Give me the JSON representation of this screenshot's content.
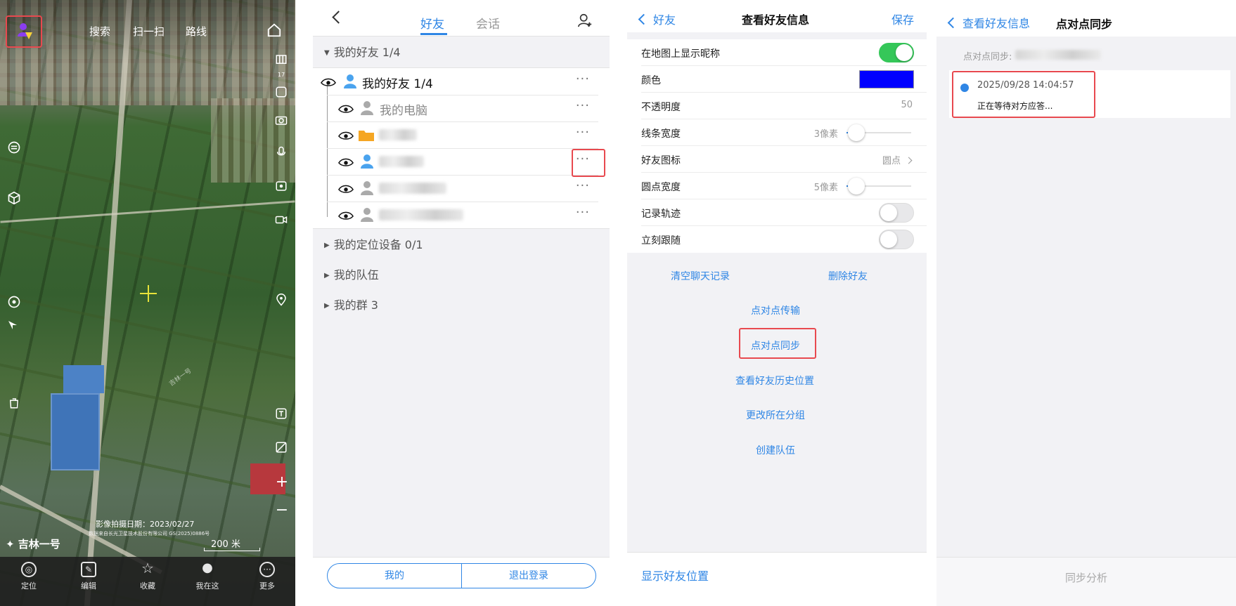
{
  "map_panel": {
    "top_nav": {
      "search": "搜索",
      "scan": "扫一扫",
      "route": "路线"
    },
    "zoom_level": "17",
    "watermark_road": "吉林一号",
    "capture_date": "影像拍摄日期：2023/02/27",
    "copyright": "数据来自长光卫星技术股份有限公司 GS(2025)0886号",
    "logo": "吉林一号",
    "scale": "200 米",
    "bottom_tabs": [
      {
        "label": "定位",
        "icon": "locate-icon"
      },
      {
        "label": "编辑",
        "icon": "edit-icon"
      },
      {
        "label": "收藏",
        "icon": "star-icon"
      },
      {
        "label": "我在这",
        "icon": "pin-icon"
      },
      {
        "label": "更多",
        "icon": "more-icon"
      }
    ]
  },
  "friends_panel": {
    "tabs": {
      "friends": "好友",
      "chat": "会话"
    },
    "groups": {
      "my_friends": "我的好友 1/4",
      "devices": "我的定位设备 0/1",
      "teams": "我的队伍",
      "crowds": "我的群 3"
    },
    "list": {
      "header": "我的好友 1/4",
      "my_computer": "我的电脑",
      "more_glyph": "···"
    },
    "bottom": {
      "mine": "我的",
      "logout": "退出登录"
    }
  },
  "info_panel": {
    "back": "好友",
    "title": "查看好友信息",
    "save": "保存",
    "rows": {
      "show_nickname": "在地图上显示昵称",
      "color": "颜色",
      "opacity": "不透明度",
      "opacity_value": "50",
      "line_width": "线条宽度",
      "line_width_value": "3像素",
      "icon": "好友图标",
      "icon_value": "圆点",
      "dot_width": "圆点宽度",
      "dot_width_value": "5像素",
      "record_track": "记录轨迹",
      "follow_now": "立刻跟随"
    },
    "colors": {
      "friend_color": "#0000ff"
    },
    "actions": {
      "clear_chat": "清空聊天记录",
      "delete_friend": "删除好友",
      "p2p_transfer": "点对点传输",
      "p2p_sync": "点对点同步",
      "history": "查看好友历史位置",
      "change_group": "更改所在分组",
      "create_team": "创建队伍"
    },
    "bottom": "显示好友位置"
  },
  "sync_panel": {
    "back": "查看好友信息",
    "title": "点对点同步",
    "sync_label": "点对点同步:",
    "time": "2025/09/28 14:04:57",
    "status": "正在等待对方应答...",
    "bottom": "同步分析"
  }
}
